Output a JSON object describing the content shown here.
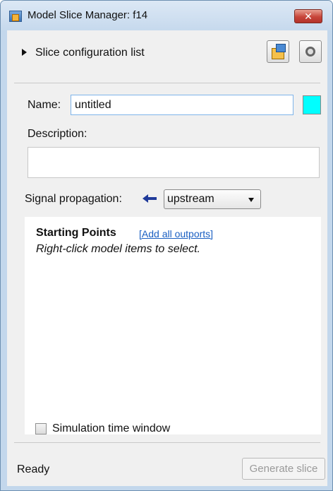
{
  "window": {
    "title": "Model Slice Manager: f14",
    "close_glyph": "✕"
  },
  "config": {
    "label": "Slice configuration list"
  },
  "form": {
    "name_label": "Name:",
    "name_value": "untitled",
    "highlight_color": "#00ffff",
    "description_label": "Description:",
    "description_value": "",
    "signal_propagation_label": "Signal propagation:",
    "signal_propagation_value": "upstream"
  },
  "starting_points": {
    "title": "Starting Points",
    "add_link": "[Add all outports]",
    "hint": "Right-click model items to select."
  },
  "simulation": {
    "label": "Simulation time window",
    "checked": false
  },
  "footer": {
    "status": "Ready",
    "generate_label": "Generate slice",
    "generate_enabled": false
  },
  "icons": {
    "app": "simulink-app-icon",
    "expand": "expand-triangle-icon",
    "refresh": "refresh-highlight-icon",
    "settings": "settings-gear-icon",
    "direction": "left-arrow-icon"
  }
}
